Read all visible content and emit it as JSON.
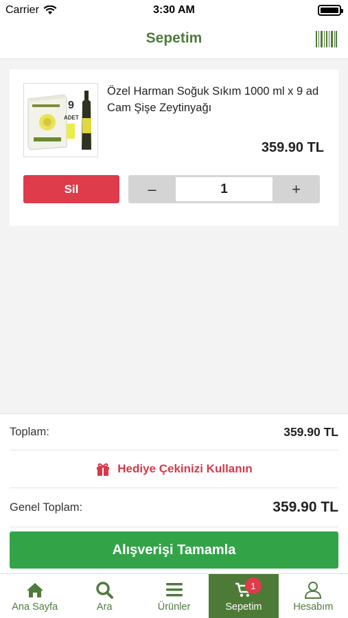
{
  "status_bar": {
    "carrier": "Carrier",
    "time": "3:30 AM"
  },
  "nav": {
    "title": "Sepetim",
    "barcode_icon": "barcode-icon"
  },
  "cart": {
    "items": [
      {
        "name": "Özel Harman Soğuk Sıkım 1000 ml x 9 ad Cam Şişe Zeytinyağı",
        "price": "359.90 TL",
        "quantity": "1",
        "delete_label": "Sil",
        "decrement_label": "–",
        "increment_label": "+"
      }
    ]
  },
  "summary": {
    "subtotal_label": "Toplam:",
    "subtotal_value": "359.90 TL",
    "gift_label": "Hediye Çekinizi Kullanın",
    "total_label": "Genel Toplam:",
    "total_value": "359.90 TL",
    "checkout_label": "Alışverişi Tamamla"
  },
  "tabs": [
    {
      "label": "Ana Sayfa",
      "icon": "home-icon"
    },
    {
      "label": "Ara",
      "icon": "search-icon"
    },
    {
      "label": "Ürünler",
      "icon": "menu-icon"
    },
    {
      "label": "Sepetim",
      "icon": "cart-icon",
      "badge": "1",
      "active": true
    },
    {
      "label": "Hesabım",
      "icon": "user-icon"
    }
  ],
  "colors": {
    "brand_green": "#4f7a3b",
    "active_tab": "#4d7a36",
    "checkout_green": "#33a348",
    "danger_red": "#de3b4b"
  }
}
